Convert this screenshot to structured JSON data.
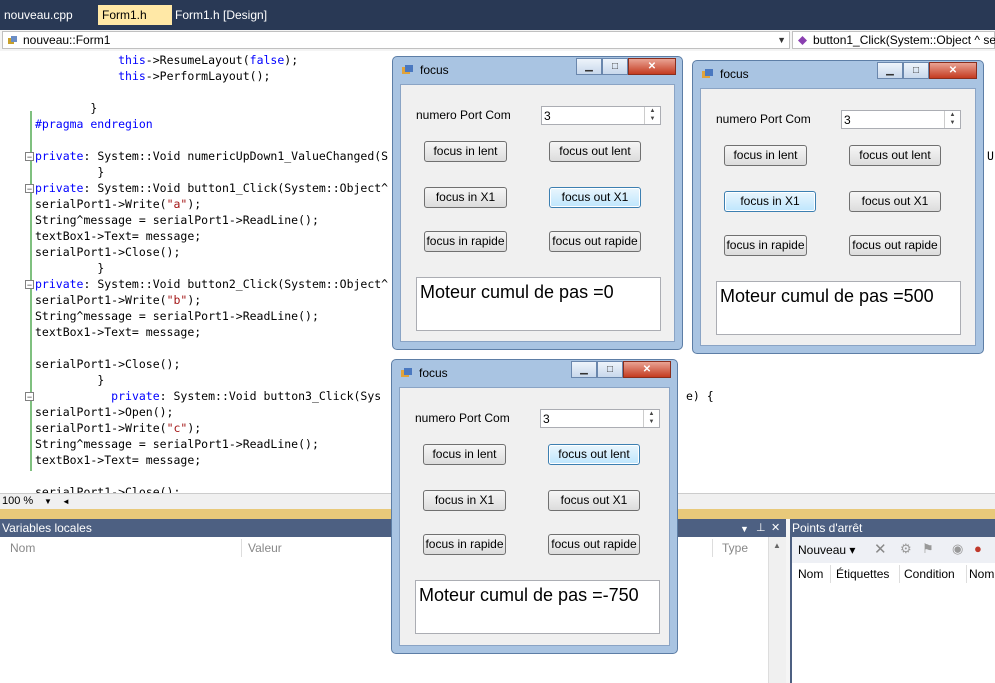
{
  "doc_tabs": [
    {
      "label": "nouveau.cpp",
      "active": false
    },
    {
      "label": "Form1.h",
      "active": true
    },
    {
      "label": "Form1.h [Design]",
      "active": false
    }
  ],
  "nav": {
    "left_combo": "nouveau::Form1",
    "right_combo": "button1_Click(System::Object ^ se"
  },
  "code_lines": [
    {
      "i": "            ",
      "parts": [
        [
          "kw",
          "this"
        ],
        [
          "",
          "->ResumeLayout("
        ],
        [
          "kw",
          "false"
        ],
        [
          "",
          ");"
        ]
      ]
    },
    {
      "i": "            ",
      "parts": [
        [
          "kw",
          "this"
        ],
        [
          "",
          "->PerformLayout();"
        ]
      ]
    },
    {
      "i": "",
      "parts": []
    },
    {
      "i": "        ",
      "parts": [
        [
          "",
          "}"
        ]
      ]
    },
    {
      "i": "",
      "parts": [
        [
          "kw",
          "#pragma endregion"
        ]
      ]
    },
    {
      "i": "",
      "parts": []
    },
    {
      "i": "",
      "parts": [
        [
          "kw",
          "private"
        ],
        [
          "",
          ": System::Void numericUpDown1_ValueChanged(S"
        ]
      ]
    },
    {
      "i": "         ",
      "parts": [
        [
          "",
          "}"
        ]
      ]
    },
    {
      "i": "",
      "parts": [
        [
          "kw",
          "private"
        ],
        [
          "",
          ": System::Void button1_Click(System::Object^"
        ]
      ]
    },
    {
      "i": "",
      "parts": [
        [
          "",
          "serialPort1->Write("
        ],
        [
          "str",
          "\"a\""
        ],
        [
          "",
          ");"
        ]
      ]
    },
    {
      "i": "",
      "parts": [
        [
          "",
          "String^message = serialPort1->ReadLine();"
        ]
      ]
    },
    {
      "i": "",
      "parts": [
        [
          "",
          "textBox1->Text= message;"
        ]
      ]
    },
    {
      "i": "",
      "parts": [
        [
          "",
          "serialPort1->Close();"
        ]
      ]
    },
    {
      "i": "         ",
      "parts": [
        [
          "",
          "}"
        ]
      ]
    },
    {
      "i": "",
      "parts": [
        [
          "kw",
          "private"
        ],
        [
          "",
          ": System::Void button2_Click(System::Object^"
        ]
      ]
    },
    {
      "i": "",
      "parts": [
        [
          "",
          "serialPort1->Write("
        ],
        [
          "str",
          "\"b\""
        ],
        [
          "",
          ");"
        ]
      ]
    },
    {
      "i": "",
      "parts": [
        [
          "",
          "String^message = serialPort1->ReadLine();"
        ]
      ]
    },
    {
      "i": "",
      "parts": [
        [
          "",
          "textBox1->Text= message;"
        ]
      ]
    },
    {
      "i": "",
      "parts": []
    },
    {
      "i": "",
      "parts": [
        [
          "",
          "serialPort1->Close();"
        ]
      ]
    },
    {
      "i": "         ",
      "parts": [
        [
          "",
          "}"
        ]
      ]
    },
    {
      "i": "           ",
      "parts": [
        [
          "kw",
          "private"
        ],
        [
          "",
          ": System::Void button3_Click(Sys"
        ]
      ]
    },
    {
      "i": "",
      "parts": [
        [
          "",
          "serialPort1->Open();"
        ]
      ]
    },
    {
      "i": "",
      "parts": [
        [
          "",
          "serialPort1->Write("
        ],
        [
          "str",
          "\"c\""
        ],
        [
          "",
          ");"
        ]
      ]
    },
    {
      "i": "",
      "parts": [
        [
          "",
          "String^message = serialPort1->ReadLine();"
        ]
      ]
    },
    {
      "i": "",
      "parts": [
        [
          "",
          "textBox1->Text= message;"
        ]
      ]
    },
    {
      "i": "",
      "parts": []
    },
    {
      "i": "",
      "parts": [
        [
          "",
          "serialPort1->Close();"
        ]
      ]
    }
  ],
  "code_right_fragments": {
    "u_char": "U",
    "brace_line": "e) {"
  },
  "zoom": {
    "level": "100 %"
  },
  "locals_panel": {
    "title": "Variables locales",
    "columns": [
      "Nom",
      "Valeur",
      "Type"
    ]
  },
  "breakpoints_panel": {
    "title": "Points d'arrêt",
    "new_button": "Nouveau",
    "columns": [
      "Nom",
      "Étiquettes",
      "Condition",
      "Nom"
    ]
  },
  "dialogs": [
    {
      "title": "focus",
      "port_label": "numero Port Com",
      "port_value": "3",
      "buttons": [
        "focus in lent",
        "focus out lent",
        "focus in X1",
        "focus out X1",
        "focus in rapide",
        "focus out rapide"
      ],
      "focused": 3,
      "output": "Moteur cumul de pas =0"
    },
    {
      "title": "focus",
      "port_label": "numero Port Com",
      "port_value": "3",
      "buttons": [
        "focus in lent",
        "focus out lent",
        "focus in X1",
        "focus out X1",
        "focus in rapide",
        "focus out rapide"
      ],
      "focused": 2,
      "output": "Moteur cumul de pas =500"
    },
    {
      "title": "focus",
      "port_label": "numero Port Com",
      "port_value": "3",
      "buttons": [
        "focus in lent",
        "focus out lent",
        "focus in X1",
        "focus out X1",
        "focus in rapide",
        "focus out rapide"
      ],
      "focused": 1,
      "output": "Moteur cumul de pas =-750"
    }
  ],
  "colors": {
    "accent": "#293955",
    "keyword": "#0000ff",
    "string": "#a31515",
    "panel_title": "#4d6082"
  }
}
